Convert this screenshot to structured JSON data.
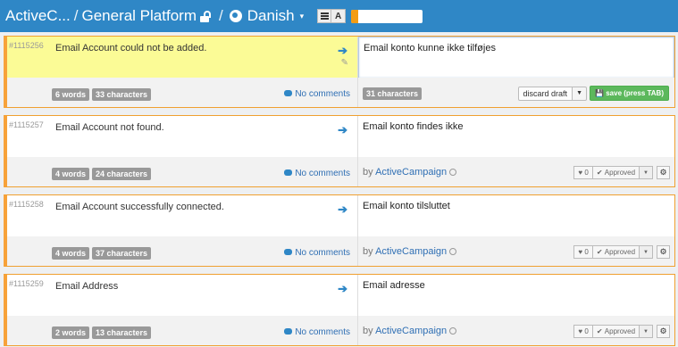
{
  "header": {
    "project": "ActiveC...",
    "separator": "/",
    "resource": "General Platform",
    "language": "Danish",
    "caret": "▾",
    "view_toggle_a": "A",
    "progress_percent": 10
  },
  "rows": [
    {
      "id": "#1115256",
      "source": "Email Account could not be added.",
      "words": "6 words",
      "chars": "33 characters",
      "comments": "No comments",
      "translation": "Email konto kunne ikke tilføjes",
      "trans_chars": "31 characters",
      "discard_label": "discard draft",
      "save_label": "save (press TAB)"
    },
    {
      "id": "#1115257",
      "source": "Email Account not found.",
      "words": "4 words",
      "chars": "24 characters",
      "comments": "No comments",
      "translation": "Email konto findes ikke",
      "by": "by",
      "author": "ActiveCampaign",
      "votes": "0",
      "status": "Approved"
    },
    {
      "id": "#1115258",
      "source": "Email Account successfully connected.",
      "words": "4 words",
      "chars": "37 characters",
      "comments": "No comments",
      "translation": "Email konto tilsluttet",
      "by": "by",
      "author": "ActiveCampaign",
      "votes": "0",
      "status": "Approved"
    },
    {
      "id": "#1115259",
      "source": "Email Address",
      "words": "2 words",
      "chars": "13 characters",
      "comments": "No comments",
      "translation": "Email adresse",
      "by": "by",
      "author": "ActiveCampaign",
      "votes": "0",
      "status": "Approved"
    }
  ],
  "icons": {
    "arrow": "arrow-right-icon",
    "pencil": "pencil-icon",
    "comment": "comment-icon",
    "lock": "lock-icon",
    "globe": "globe-icon",
    "heart": "heart-icon",
    "check": "check-icon",
    "gear": "gear-icon",
    "clock": "clock-icon"
  },
  "colors": {
    "header": "#2f87c6",
    "row_border": "#f7a23a",
    "active_source_bg": "#fbfb96",
    "save_button": "#5cb85c",
    "link": "#2f6fb4"
  }
}
